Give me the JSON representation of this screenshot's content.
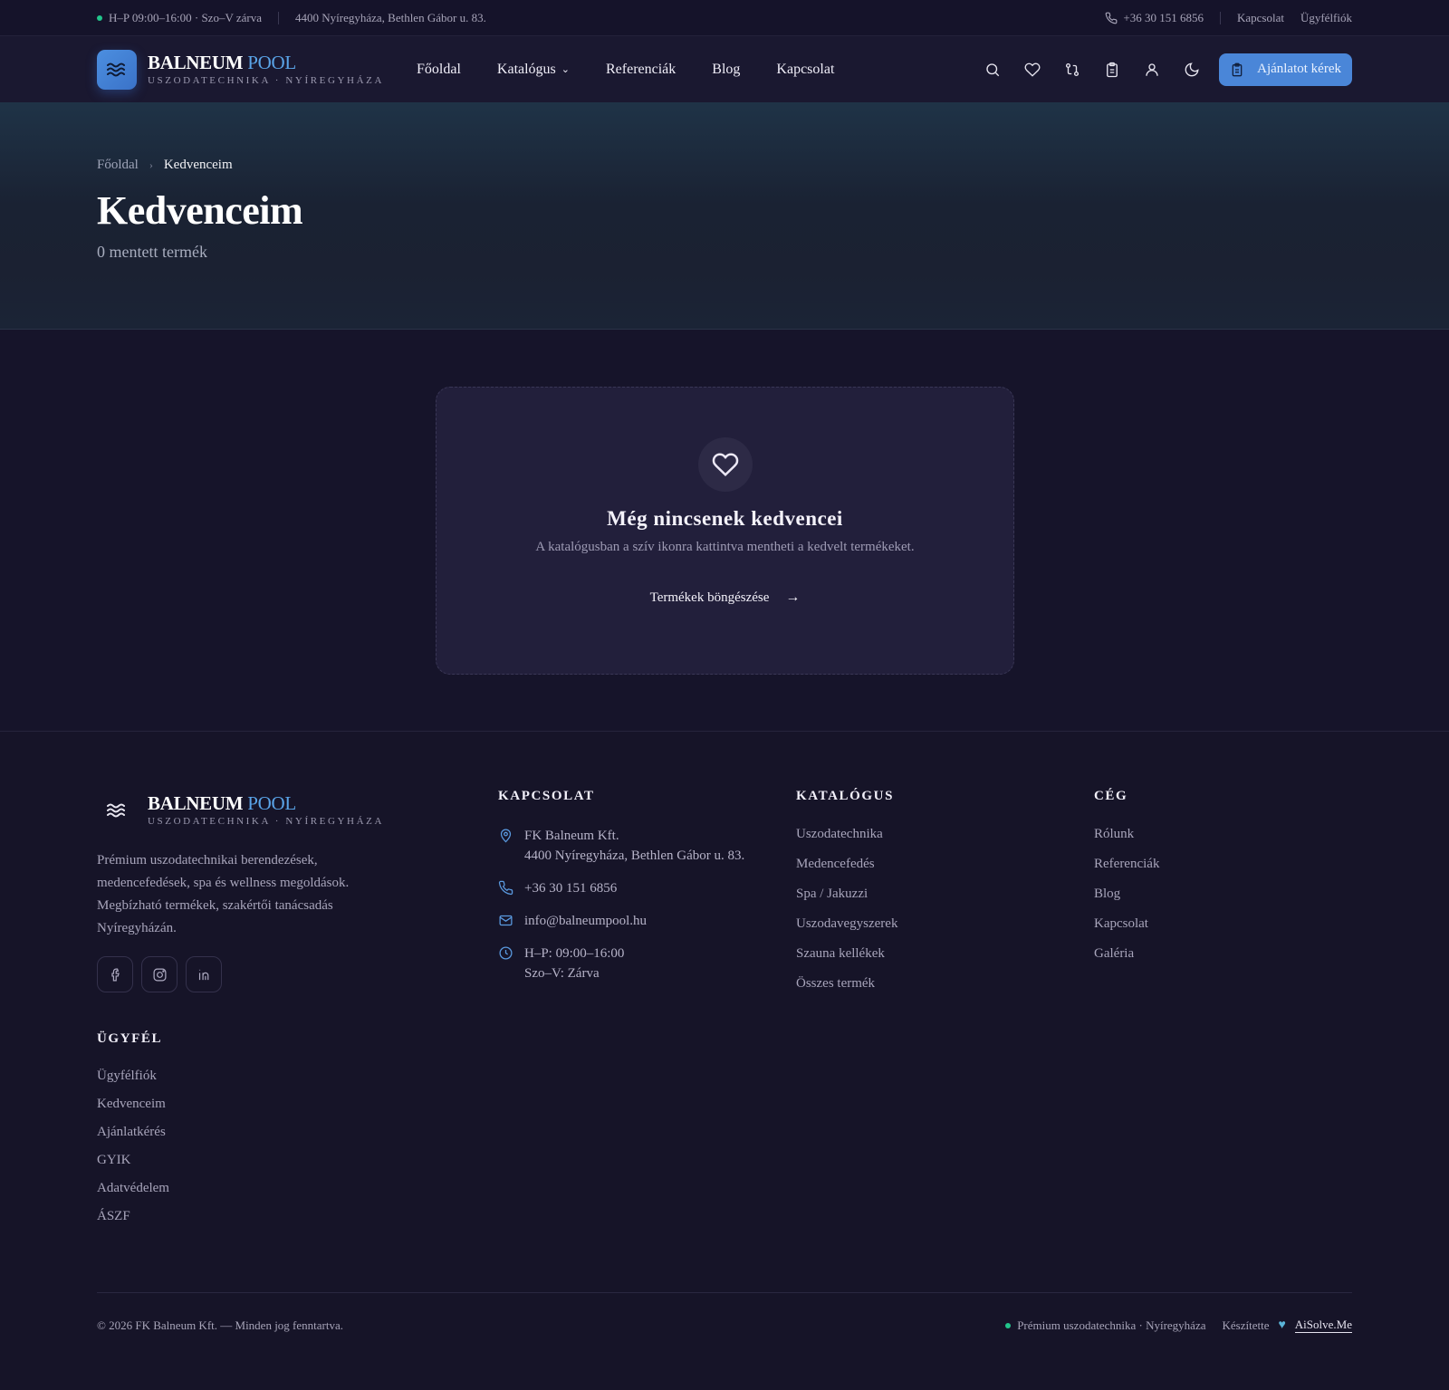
{
  "topbar": {
    "hours": "H–P 09:00–16:00 · Szo–V zárva",
    "address": "4400 Nyíregyháza, Bethlen Gábor u. 83.",
    "phone": "+36 30 151 6856",
    "contact_link": "Kapcsolat",
    "account_link": "Ügyfélfiók"
  },
  "brand": {
    "name_a": "BALNEUM",
    "name_b": "POOL",
    "subtitle": "USZODATECHNIKA · NYÍREGYHÁZA"
  },
  "nav": {
    "home": "Főoldal",
    "catalog": "Katalógus",
    "references": "Referenciák",
    "blog": "Blog",
    "contact": "Kapcsolat"
  },
  "header": {
    "icons": [
      "search-icon",
      "heart-icon",
      "compare-icon",
      "clipboard-icon",
      "user-icon",
      "moon-icon"
    ],
    "cta_label": "Ajánlatot kérek"
  },
  "hero": {
    "breadcrumb_home": "Főoldal",
    "breadcrumb_current": "Kedvenceim",
    "title": "Kedvenceim",
    "count": "0 mentett termék"
  },
  "empty": {
    "title": "Még nincsenek kedvencei",
    "text": "A katalógusban a szív ikonra kattintva mentheti a kedvelt termékeket.",
    "button": "Termékek böngészése"
  },
  "footer": {
    "description": "Prémium uszodatechnikai berendezések, medencefedések, spa és wellness megoldások. Megbízható termékek, szakértői tanácsadás Nyíregyházán.",
    "contact_heading": "KAPCSOLAT",
    "contact_company": "FK Balneum Kft.",
    "contact_address": "4400 Nyíregyháza, Bethlen Gábor u. 83.",
    "contact_phone": "+36 30 151 6856",
    "contact_email": "info@balneumpool.hu",
    "contact_hours_1": "H–P: 09:00–16:00",
    "contact_hours_2": "Szo–V: Zárva",
    "catalog_heading": "KATALÓGUS",
    "catalog_links": [
      "Uszodatechnika",
      "Medencefedés",
      "Spa / Jakuzzi",
      "Uszodavegyszerek",
      "Szauna kellékek",
      "Összes termék"
    ],
    "company_heading": "CÉG",
    "company_links": [
      "Rólunk",
      "Referenciák",
      "Blog",
      "Kapcsolat",
      "Galéria"
    ],
    "client_heading": "ÜGYFÉL",
    "client_links": [
      "Ügyfélfiók",
      "Kedvenceim",
      "Ajánlatkérés",
      "GYIK",
      "Adatvédelem",
      "ÁSZF"
    ],
    "copyright": "© 2026 FK Balneum Kft. — Minden jog fenntartva.",
    "tagline": "Prémium uszodatechnika · Nyíregyháza",
    "made_by": "Készítette",
    "made_by_link": "AiSolve.Me"
  },
  "colors": {
    "accent": "#4a86d8",
    "status_dot": "#22c58b",
    "background": "#16142a"
  }
}
